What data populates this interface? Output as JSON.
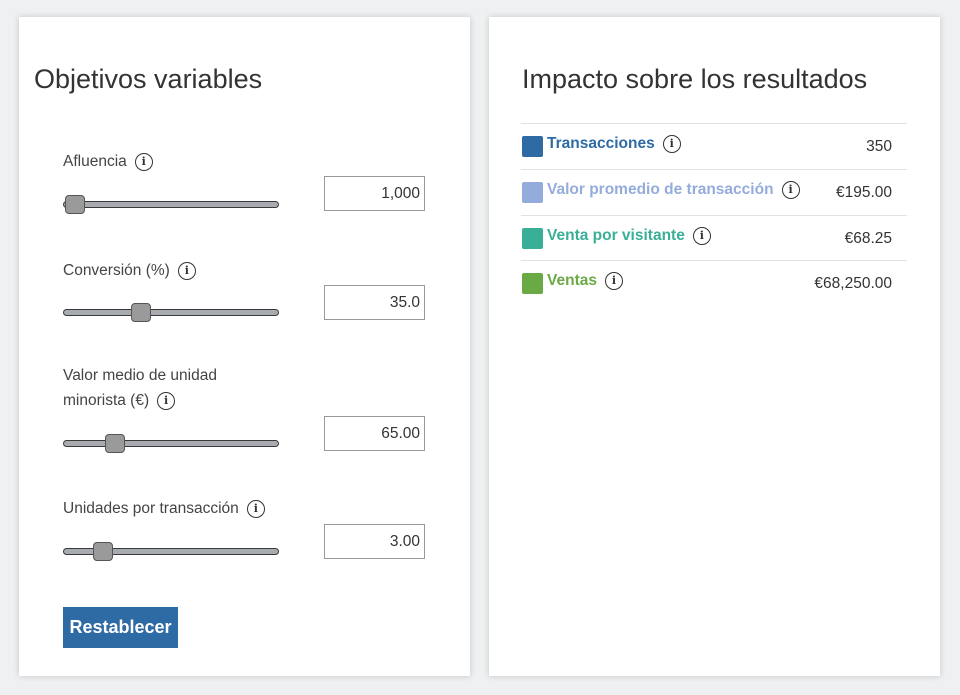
{
  "left_panel": {
    "title": "Objetivos variables",
    "controls": [
      {
        "label": "Afluencia",
        "value": "1,000",
        "level": 0.05
      },
      {
        "label": "Conversión (%)",
        "value": "35.0",
        "level": 0.36
      },
      {
        "label": "Valor medio de unidad minorista (€)",
        "value": "65.00",
        "level": 0.24
      },
      {
        "label": "Unidades por transacción",
        "value": "3.00",
        "level": 0.18
      }
    ],
    "reset_label": "Restablecer"
  },
  "right_panel": {
    "title": "Impacto sobre los resultados",
    "results": [
      {
        "label": "Transacciones",
        "value": "350",
        "color": "#2e6aa3"
      },
      {
        "label": "Valor promedio de transacción",
        "value": "€195.00",
        "color": "#94acdc"
      },
      {
        "label": "Venta por visitante",
        "value": "€68.25",
        "color": "#3aaf98"
      },
      {
        "label": "Ventas",
        "value": "€68,250.00",
        "color": "#6aaa45"
      }
    ]
  },
  "colors": {
    "accent": "#2e6aa3"
  },
  "icons": {
    "info": "info-icon"
  }
}
